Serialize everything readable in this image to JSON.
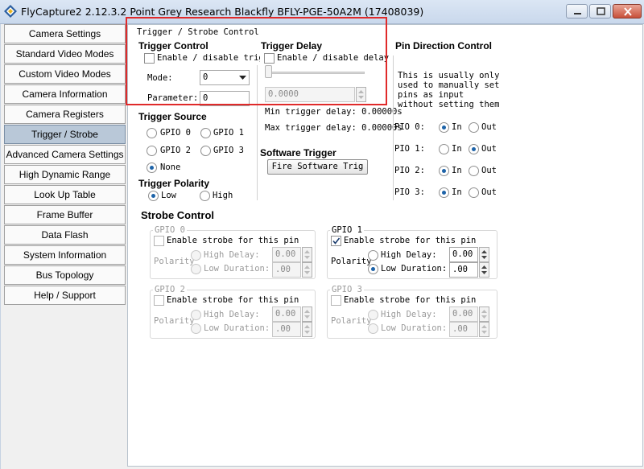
{
  "window": {
    "title": "FlyCapture2 2.12.3.2  Point Grey Research Blackfly BFLY-PGE-50A2M (17408039)"
  },
  "sidebar": {
    "items": [
      {
        "label": "Camera Settings"
      },
      {
        "label": "Standard Video Modes"
      },
      {
        "label": "Custom Video Modes"
      },
      {
        "label": "Camera Information"
      },
      {
        "label": "Camera Registers"
      },
      {
        "label": "Trigger / Strobe",
        "active": true
      },
      {
        "label": "Advanced Camera Settings"
      },
      {
        "label": "High Dynamic Range"
      },
      {
        "label": "Look Up Table"
      },
      {
        "label": "Frame Buffer"
      },
      {
        "label": "Data Flash"
      },
      {
        "label": "System Information"
      },
      {
        "label": "Bus Topology"
      },
      {
        "label": "Help / Support"
      }
    ]
  },
  "trigger_strobe": {
    "group_title": "Trigger / Strobe Control",
    "trigger_control": {
      "heading": "Trigger Control",
      "enable_label": "Enable / disable trigg",
      "mode_label": "Mode:",
      "mode_value": "0",
      "parameter_label": "Parameter:",
      "parameter_value": "0"
    },
    "trigger_delay": {
      "heading": "Trigger Delay",
      "enable_label": "Enable / disable delay",
      "value": "0.0000",
      "slider_level": 0,
      "min_label": "Min trigger delay: 0.00000s",
      "max_label": "Max trigger delay: 0.00000s"
    },
    "trigger_source": {
      "heading": "Trigger Source",
      "options": [
        "GPIO 0",
        "GPIO 1",
        "GPIO 2",
        "GPIO 3",
        "None"
      ],
      "selected": "None"
    },
    "trigger_polarity": {
      "heading": "Trigger Polarity",
      "low": "Low",
      "high": "High",
      "selected": "Low"
    },
    "software_trigger": {
      "heading": "Software Trigger",
      "button_label": "Fire Software Trig"
    },
    "pin_direction": {
      "heading": "Pin Direction Control",
      "note": [
        "This is usually only",
        "used to manually set",
        "pins as input",
        "without setting them"
      ],
      "in_label": "In",
      "out_label": "Out",
      "pins": [
        {
          "label": "PIO 0:",
          "selected": "In"
        },
        {
          "label": "PIO 1:",
          "selected": "Out"
        },
        {
          "label": "PIO 2:",
          "selected": "In"
        },
        {
          "label": "PIO 3:",
          "selected": "In"
        }
      ]
    },
    "strobe_control": {
      "heading": "Strobe Control",
      "enable_label": "Enable strobe for this pin",
      "polarity_label": "Polarity",
      "high_delay_label": "High Delay:",
      "low_duration_label": "Low  Duration:",
      "gpios": [
        {
          "title": "GPIO 0",
          "enabled": false,
          "delay": "0.00",
          "duration": ".00"
        },
        {
          "title": "GPIO 1",
          "enabled": true,
          "delay": "0.00",
          "duration": ".00"
        },
        {
          "title": "GPIO 2",
          "enabled": false,
          "delay": "0.00",
          "duration": ".00"
        },
        {
          "title": "GPIO 3",
          "enabled": false,
          "delay": "0.00",
          "duration": ".00"
        }
      ]
    }
  },
  "colors": {
    "accent": "#1d63a8",
    "highlight": "#e02a2a",
    "active_nav": "#b9c8d8"
  }
}
